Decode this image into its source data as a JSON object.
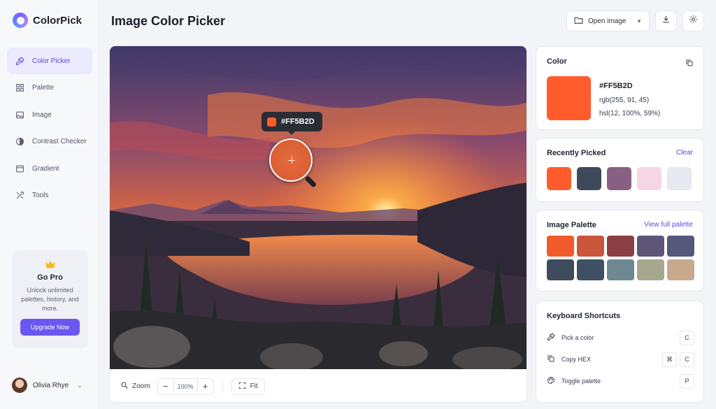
{
  "app": {
    "name": "ColorPick"
  },
  "sidebar": {
    "items": [
      {
        "label": "Color Picker",
        "icon": "eyedropper-icon",
        "active": true
      },
      {
        "label": "Palette",
        "icon": "grid-icon",
        "active": false
      },
      {
        "label": "Image",
        "icon": "image-icon",
        "active": false
      },
      {
        "label": "Contrast Checker",
        "icon": "contrast-icon",
        "active": false
      },
      {
        "label": "Gradient",
        "icon": "gradient-icon",
        "active": false
      },
      {
        "label": "Tools",
        "icon": "tools-icon",
        "active": false
      }
    ],
    "promo": {
      "title": "Go Pro",
      "description": "Unlock unlimited palettes, history, and more.",
      "button": "Upgrade Now"
    },
    "user": {
      "name": "Olivia Rhye"
    }
  },
  "header": {
    "title": "Image Color Picker",
    "open_image": "Open image"
  },
  "canvas": {
    "tooltip_hex": "#FF5B2D",
    "zoom_label": "Zoom",
    "zoom_value": "100%",
    "fit_label": "Fit"
  },
  "color_panel": {
    "title": "Color",
    "hex": "#FF5B2D",
    "rgb": "rgb(255, 91, 45)",
    "hsl": "hsl(12, 100%, 59%)",
    "swatch": "#FF5B2D"
  },
  "recent": {
    "title": "Recently Picked",
    "clear": "Clear",
    "colors": [
      "#FF5B2D",
      "#3E4A5C",
      "#8A5F84",
      "#F6D6E4",
      "#E7E8F0"
    ]
  },
  "palette": {
    "title": "Image Palette",
    "link": "View full palette",
    "colors": [
      "#F15A2B",
      "#C9563A",
      "#8B3F45",
      "#5D5677",
      "#55587A",
      "#3E4B5C",
      "#3F5062",
      "#6F8790",
      "#A5A88D",
      "#C9A98B"
    ]
  },
  "shortcuts": {
    "title": "Keyboard Shortcuts",
    "items": [
      {
        "label": "Pick a color",
        "icon": "eyedropper-icon",
        "keys": [
          "C"
        ]
      },
      {
        "label": "Copy HEX",
        "icon": "copy-icon",
        "keys": [
          "⌘",
          "C"
        ]
      },
      {
        "label": "Toggle palette",
        "icon": "palette-icon",
        "keys": [
          "P"
        ]
      }
    ]
  }
}
